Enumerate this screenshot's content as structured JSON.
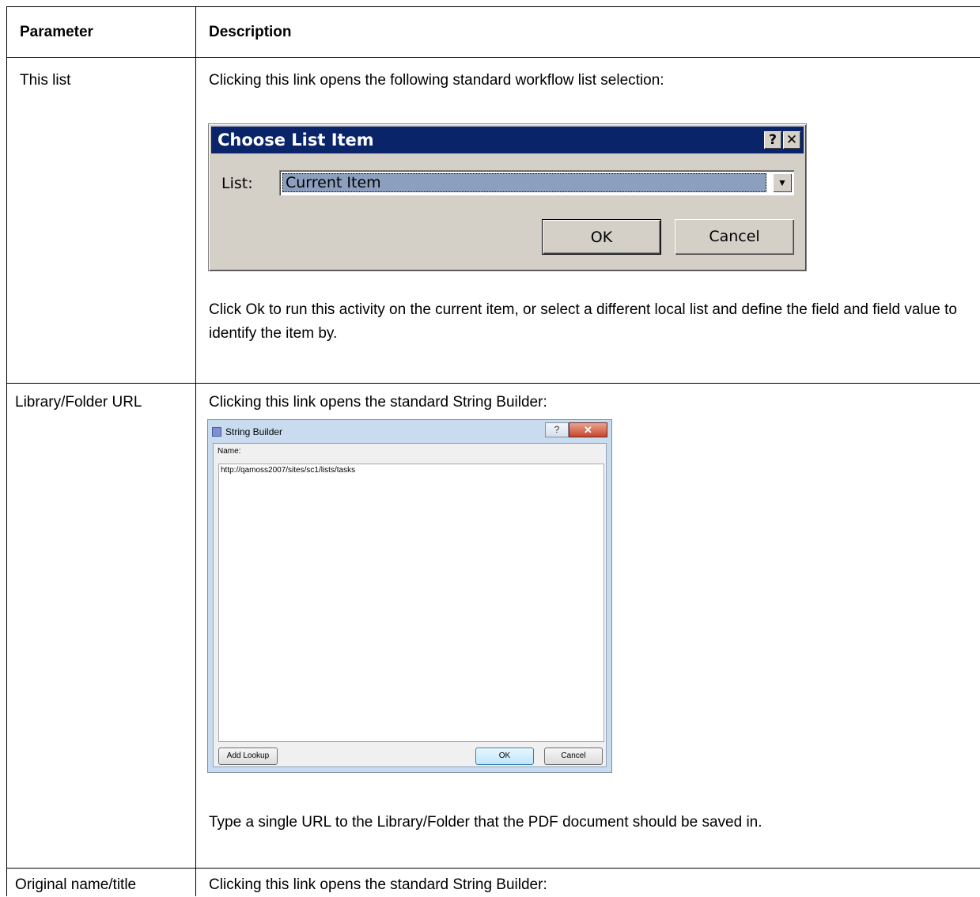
{
  "table": {
    "headers": [
      "Parameter",
      "Description"
    ],
    "rows": [
      {
        "parameter": "This list",
        "intro": "Clicking this link opens the following standard workflow list selection:",
        "after": "Click Ok to run this activity on the current item, or select a different local list and define the field and field value to identify the item by."
      },
      {
        "parameter": "Library/Folder URL",
        "intro": "Clicking this link opens the standard String Builder:",
        "after": "Type a single URL to the Library/Folder that the PDF document should be saved in."
      },
      {
        "parameter": "Original name/title",
        "intro": "Clicking this link opens the standard String Builder:"
      }
    ]
  },
  "choose_list_dialog": {
    "title": "Choose List Item",
    "help_glyph": "?",
    "close_glyph": "✕",
    "list_label": "List:",
    "list_value": "Current Item",
    "dropdown_glyph": "▼",
    "ok_label": "OK",
    "cancel_label": "Cancel"
  },
  "string_builder_dialog": {
    "title": "String Builder",
    "help_glyph": "?",
    "close_glyph": "✕",
    "name_label": "Name:",
    "value": "http://qamoss2007/sites/sc1/lists/tasks",
    "add_lookup_label": "Add Lookup",
    "ok_label": "OK",
    "cancel_label": "Cancel"
  }
}
